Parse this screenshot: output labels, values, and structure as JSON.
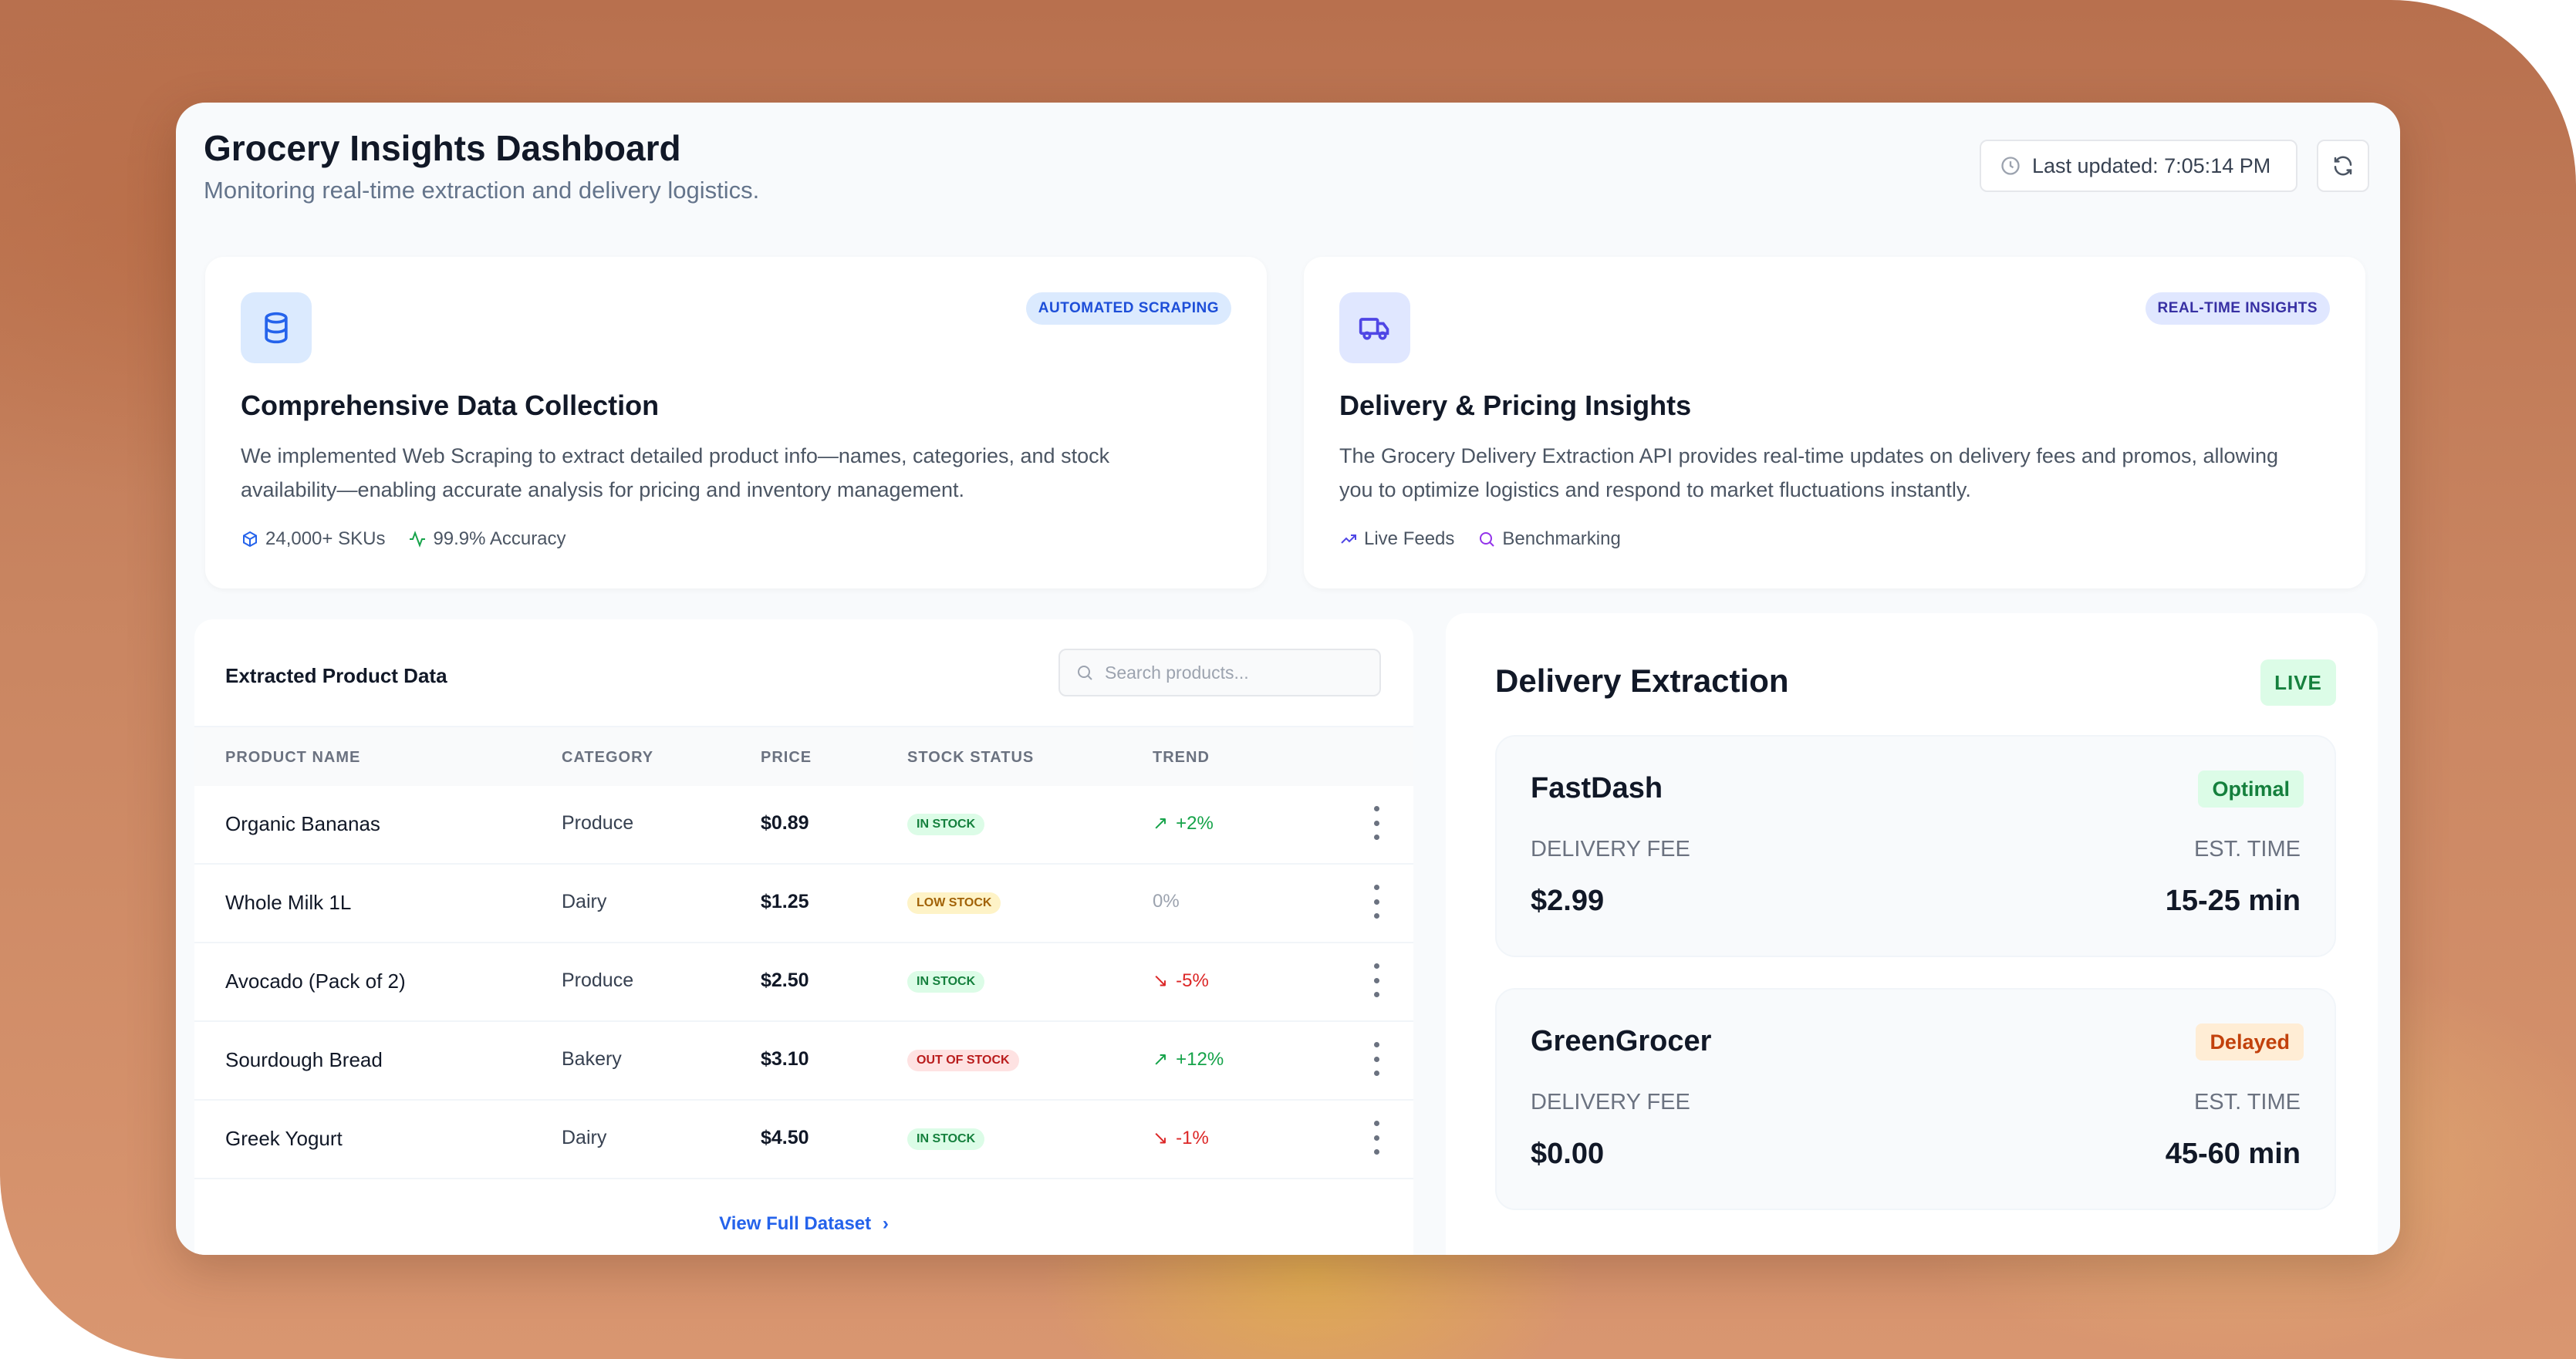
{
  "header": {
    "title": "Grocery Insights Dashboard",
    "subtitle": "Monitoring real-time extraction and delivery logistics.",
    "last_updated": "Last updated: 7:05:14 PM"
  },
  "features": [
    {
      "badge": "AUTOMATED SCRAPING",
      "title": "Comprehensive Data Collection",
      "description": "We implemented Web Scraping to extract detailed product info—names, categories, and stock availability—enabling accurate analysis for pricing and inventory management.",
      "stats": [
        "24,000+ SKUs",
        "99.9% Accuracy"
      ]
    },
    {
      "badge": "REAL-TIME INSIGHTS",
      "title": "Delivery & Pricing Insights",
      "description": "The Grocery Delivery Extraction API provides real-time updates on delivery fees and promos, allowing you to optimize logistics and respond to market fluctuations instantly.",
      "stats": [
        "Live Feeds",
        "Benchmarking"
      ]
    }
  ],
  "products": {
    "title": "Extracted Product Data",
    "search_placeholder": "Search products...",
    "columns": [
      "PRODUCT NAME",
      "CATEGORY",
      "PRICE",
      "STOCK STATUS",
      "TREND"
    ],
    "rows": [
      {
        "name": "Organic Bananas",
        "category": "Produce",
        "price": "$0.89",
        "status": "IN STOCK",
        "trend": "+2%"
      },
      {
        "name": "Whole Milk 1L",
        "category": "Dairy",
        "price": "$1.25",
        "status": "LOW STOCK",
        "trend": "0%"
      },
      {
        "name": "Avocado (Pack of 2)",
        "category": "Produce",
        "price": "$2.50",
        "status": "IN STOCK",
        "trend": "-5%"
      },
      {
        "name": "Sourdough Bread",
        "category": "Bakery",
        "price": "$3.10",
        "status": "OUT OF STOCK",
        "trend": "+12%"
      },
      {
        "name": "Greek Yogurt",
        "category": "Dairy",
        "price": "$4.50",
        "status": "IN STOCK",
        "trend": "-1%"
      }
    ],
    "view_all": "View Full Dataset"
  },
  "delivery": {
    "title": "Delivery Extraction",
    "live_badge": "LIVE",
    "providers": [
      {
        "name": "FastDash",
        "status": "Optimal",
        "fee_label": "DELIVERY FEE",
        "time_label": "EST. TIME",
        "fee": "$2.99",
        "time": "15-25 min"
      },
      {
        "name": "GreenGrocer",
        "status": "Delayed",
        "fee_label": "DELIVERY FEE",
        "time_label": "EST. TIME",
        "fee": "$0.00",
        "time": "45-60 min"
      }
    ]
  },
  "colors": {
    "accent_blue": "#2563eb",
    "green": "#16a34a",
    "red": "#dc2626",
    "amber": "#a16207"
  }
}
